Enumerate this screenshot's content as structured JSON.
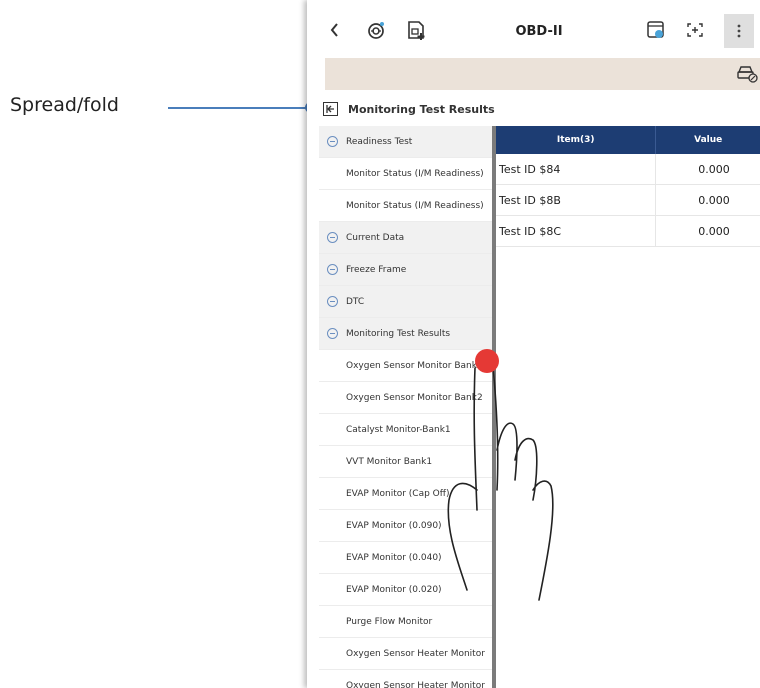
{
  "callout": {
    "label": "Spread/fold"
  },
  "header": {
    "title": "OBD-II",
    "back_icon": "chevron-left-icon",
    "more_icon": "vertical-dots-icon"
  },
  "section": {
    "title": "Monitoring Test Results"
  },
  "tree": {
    "items": [
      {
        "label": "Readiness Test",
        "type": "group"
      },
      {
        "label": "Monitor Status (I/M Readiness)",
        "type": "child"
      },
      {
        "label": "Monitor Status (I/M Readiness)",
        "type": "child"
      },
      {
        "label": "Current Data",
        "type": "group"
      },
      {
        "label": "Freeze Frame",
        "type": "group"
      },
      {
        "label": "DTC",
        "type": "group"
      },
      {
        "label": "Monitoring Test Results",
        "type": "group"
      },
      {
        "label": "Oxygen Sensor Monitor Bank1",
        "type": "child"
      },
      {
        "label": "Oxygen Sensor Monitor Bank2",
        "type": "child"
      },
      {
        "label": "Catalyst Monitor-Bank1",
        "type": "child"
      },
      {
        "label": "VVT Monitor Bank1",
        "type": "child"
      },
      {
        "label": "EVAP Monitor (Cap Off)",
        "type": "child"
      },
      {
        "label": "EVAP Monitor (0.090)",
        "type": "child"
      },
      {
        "label": "EVAP Monitor (0.040)",
        "type": "child"
      },
      {
        "label": "EVAP Monitor (0.020)",
        "type": "child"
      },
      {
        "label": "Purge Flow Monitor",
        "type": "child"
      },
      {
        "label": "Oxygen Sensor Heater Monitor",
        "type": "child"
      },
      {
        "label": "Oxygen Sensor Heater Monitor",
        "type": "child"
      }
    ]
  },
  "table": {
    "headers": {
      "item": "Item(3)",
      "value": "Value"
    },
    "rows": [
      {
        "item": "Test ID $84",
        "value": "0.000"
      },
      {
        "item": "Test ID $8B",
        "value": "0.000"
      },
      {
        "item": "Test ID $8C",
        "value": "0.000"
      }
    ]
  },
  "colors": {
    "table_header": "#1d3d73",
    "accent": "#4a7ebb",
    "toolbar": "#ebe2d9",
    "touch_dot": "#e53935"
  }
}
